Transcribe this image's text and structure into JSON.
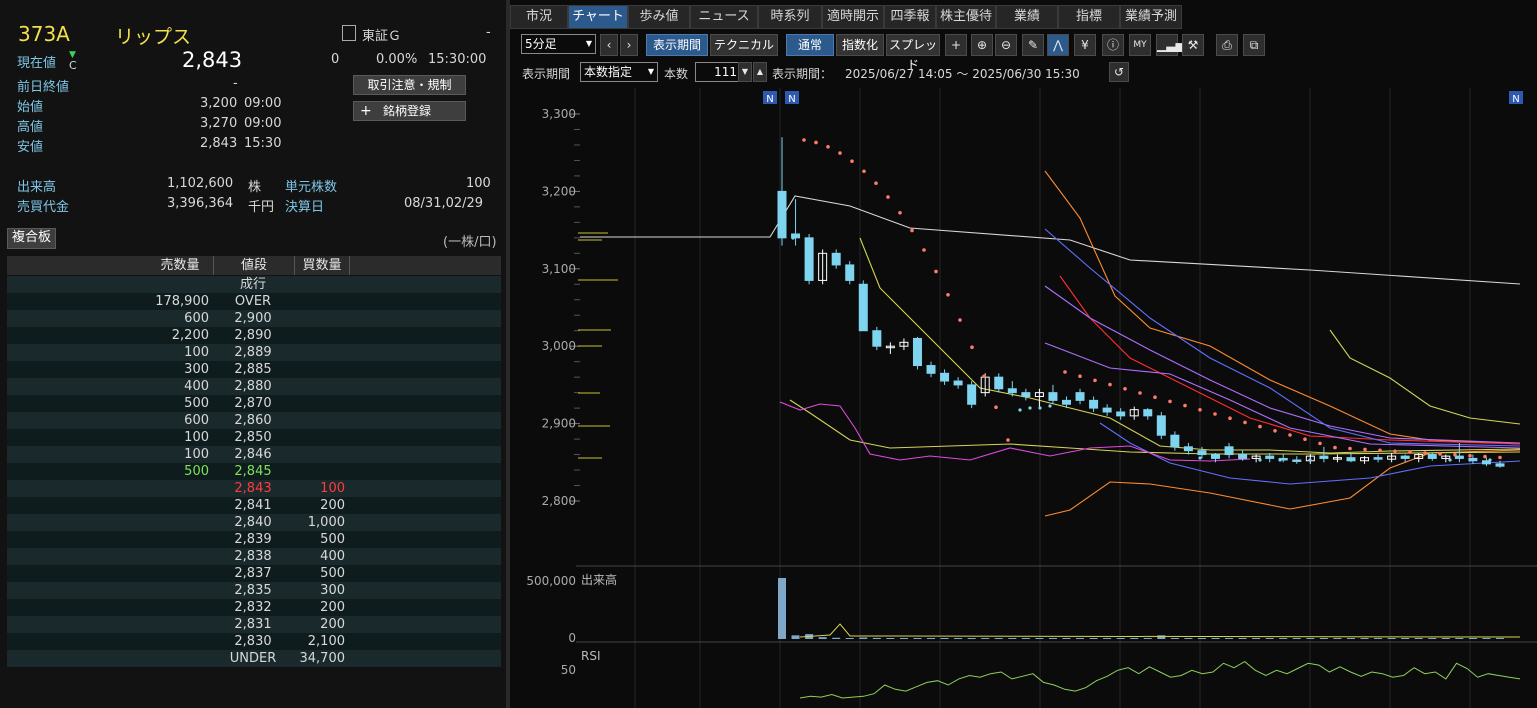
{
  "stock": {
    "code": "373A",
    "name": "リップス",
    "market": "東証Ｇ",
    "market_extra": "-",
    "current_label": "現在値",
    "current_mark": "C",
    "current_value": "2,843",
    "change": "0",
    "change_pct": "0.00%",
    "time": "15:30:00",
    "prev_close_label": "前日終値",
    "prev_close_value": "-",
    "open_label": "始値",
    "open_value": "3,200",
    "open_time": "09:00",
    "high_label": "高値",
    "high_value": "3,270",
    "high_time": "09:00",
    "low_label": "安値",
    "low_value": "2,843",
    "low_time": "15:30",
    "volume_label": "出来高",
    "volume_value": "1,102,600",
    "volume_unit": "株",
    "unit_label": "単元株数",
    "unit_value": "100",
    "turnover_label": "売買代金",
    "turnover_value": "3,396,364",
    "turnover_unit": "千円",
    "settle_label": "決算日",
    "settle_value": "08/31,02/29",
    "btn_caution": "取引注意・規制",
    "btn_register": "銘柄登録",
    "btn_register_icon": "+"
  },
  "board": {
    "tab_label": "複合板",
    "unit_note": "(一株/口)",
    "headers": [
      "売数量",
      "値段",
      "買数量"
    ],
    "rows": [
      {
        "sell": "",
        "price": "成行",
        "buy": ""
      },
      {
        "sell": "178,900",
        "price": "OVER",
        "buy": ""
      },
      {
        "sell": "600",
        "price": "2,900",
        "buy": ""
      },
      {
        "sell": "2,200",
        "price": "2,890",
        "buy": ""
      },
      {
        "sell": "100",
        "price": "2,889",
        "buy": ""
      },
      {
        "sell": "300",
        "price": "2,885",
        "buy": ""
      },
      {
        "sell": "400",
        "price": "2,880",
        "buy": ""
      },
      {
        "sell": "500",
        "price": "2,870",
        "buy": ""
      },
      {
        "sell": "600",
        "price": "2,860",
        "buy": ""
      },
      {
        "sell": "100",
        "price": "2,850",
        "buy": ""
      },
      {
        "sell": "100",
        "price": "2,846",
        "buy": ""
      },
      {
        "sell": "500",
        "price": "2,845",
        "buy": ""
      },
      {
        "sell": "",
        "price": "2,843",
        "buy": "100"
      },
      {
        "sell": "",
        "price": "2,841",
        "buy": "200"
      },
      {
        "sell": "",
        "price": "2,840",
        "buy": "1,000"
      },
      {
        "sell": "",
        "price": "2,839",
        "buy": "500"
      },
      {
        "sell": "",
        "price": "2,838",
        "buy": "400"
      },
      {
        "sell": "",
        "price": "2,837",
        "buy": "500"
      },
      {
        "sell": "",
        "price": "2,835",
        "buy": "300"
      },
      {
        "sell": "",
        "price": "2,832",
        "buy": "200"
      },
      {
        "sell": "",
        "price": "2,831",
        "buy": "200"
      },
      {
        "sell": "",
        "price": "2,830",
        "buy": "2,100"
      },
      {
        "sell": "",
        "price": "UNDER",
        "buy": "34,700"
      }
    ],
    "highlight_sell_color": "#7fe05a",
    "highlight_price_color": "#ff3b3b"
  },
  "tabs": [
    "市況",
    "チャート",
    "歩み値",
    "ニュース",
    "時系列",
    "適時開示",
    "四季報",
    "株主優待",
    "業績",
    "指標",
    "業績予測"
  ],
  "active_tab": "チャート",
  "toolbar": {
    "interval": "5分足",
    "btn_period": "表示期間",
    "btn_technical": "テクニカル",
    "btn_normal": "通常",
    "btn_index": "指数化",
    "btn_spread": "スプレッド",
    "period_label": "表示期間",
    "period_mode": "本数指定",
    "count_label": "本数",
    "count_value": "111",
    "range_label": "表示期間：",
    "range_value": "2025/06/27 14:05 ～ 2025/06/30 15:30",
    "icons": [
      "crosshair-icon",
      "zoom-in-icon",
      "zoom-out-icon",
      "pencil-icon",
      "chart-style-icon",
      "yen-icon",
      "info-icon",
      "my-icon",
      "volume-profile-icon",
      "wrench-icon",
      "print-icon",
      "popout-icon"
    ]
  },
  "chart": {
    "y_ticks": [
      "3,300",
      "3,200",
      "3,100",
      "3,000",
      "2,900",
      "2,800"
    ],
    "news_markers": [
      "N",
      "N",
      "N"
    ],
    "volume_label": "出来高",
    "volume_ticks": [
      "500,000",
      "0"
    ],
    "rsi_label": "RSI",
    "rsi_ticks": [
      "50"
    ],
    "colors": {
      "up": "#ffffff",
      "down": "#7fd4f0",
      "sar": "#ff7a6a",
      "ma_white": "#d8d8d8",
      "ma_orange": "#ff8c30",
      "ma_red": "#ff3030",
      "ma_purple": "#b070ff",
      "ma_blue": "#6070ff",
      "ma_yellow": "#d4d45a",
      "ma_magenta": "#e04ae0",
      "rsi": "#8fd05a"
    }
  },
  "chart_data": {
    "type": "candlestick",
    "title": "",
    "ylim": [
      2750,
      3320
    ],
    "candles": [
      {
        "o": 3200,
        "h": 3270,
        "l": 3130,
        "c": 3140
      },
      {
        "o": 3145,
        "h": 3190,
        "l": 3130,
        "c": 3140
      },
      {
        "o": 3140,
        "h": 3145,
        "l": 3080,
        "c": 3085
      },
      {
        "o": 3085,
        "h": 3125,
        "l": 3080,
        "c": 3120
      },
      {
        "o": 3120,
        "h": 3125,
        "l": 3100,
        "c": 3105
      },
      {
        "o": 3105,
        "h": 3110,
        "l": 3080,
        "c": 3085
      },
      {
        "o": 3080,
        "h": 3085,
        "l": 3020,
        "c": 3020
      },
      {
        "o": 3020,
        "h": 3025,
        "l": 2995,
        "c": 3000
      },
      {
        "o": 3000,
        "h": 3005,
        "l": 2990,
        "c": 3000
      },
      {
        "o": 3000,
        "h": 3010,
        "l": 2995,
        "c": 3005
      },
      {
        "o": 3010,
        "h": 3012,
        "l": 2970,
        "c": 2975
      },
      {
        "o": 2975,
        "h": 2980,
        "l": 2960,
        "c": 2965
      },
      {
        "o": 2965,
        "h": 2970,
        "l": 2950,
        "c": 2955
      },
      {
        "o": 2955,
        "h": 2960,
        "l": 2945,
        "c": 2950
      },
      {
        "o": 2950,
        "h": 2955,
        "l": 2920,
        "c": 2925
      },
      {
        "o": 2940,
        "h": 2965,
        "l": 2935,
        "c": 2960
      },
      {
        "o": 2960,
        "h": 2965,
        "l": 2940,
        "c": 2945
      },
      {
        "o": 2945,
        "h": 2955,
        "l": 2935,
        "c": 2940
      },
      {
        "o": 2940,
        "h": 2945,
        "l": 2930,
        "c": 2935
      },
      {
        "o": 2935,
        "h": 2945,
        "l": 2920,
        "c": 2940
      },
      {
        "o": 2940,
        "h": 2950,
        "l": 2925,
        "c": 2930
      },
      {
        "o": 2930,
        "h": 2935,
        "l": 2920,
        "c": 2925
      },
      {
        "o": 2940,
        "h": 2945,
        "l": 2925,
        "c": 2930
      },
      {
        "o": 2930,
        "h": 2935,
        "l": 2915,
        "c": 2920
      },
      {
        "o": 2920,
        "h": 2925,
        "l": 2910,
        "c": 2915
      },
      {
        "o": 2915,
        "h": 2920,
        "l": 2905,
        "c": 2910
      },
      {
        "o": 2910,
        "h": 2922,
        "l": 2905,
        "c": 2918
      },
      {
        "o": 2918,
        "h": 2920,
        "l": 2905,
        "c": 2910
      },
      {
        "o": 2910,
        "h": 2915,
        "l": 2880,
        "c": 2885
      },
      {
        "o": 2885,
        "h": 2890,
        "l": 2865,
        "c": 2870
      },
      {
        "o": 2870,
        "h": 2875,
        "l": 2860,
        "c": 2865
      },
      {
        "o": 2865,
        "h": 2870,
        "l": 2855,
        "c": 2860
      },
      {
        "o": 2860,
        "h": 2862,
        "l": 2850,
        "c": 2855
      },
      {
        "o": 2870,
        "h": 2875,
        "l": 2855,
        "c": 2860
      },
      {
        "o": 2860,
        "h": 2865,
        "l": 2852,
        "c": 2855
      },
      {
        "o": 2855,
        "h": 2860,
        "l": 2850,
        "c": 2858
      },
      {
        "o": 2858,
        "h": 2862,
        "l": 2850,
        "c": 2855
      },
      {
        "o": 2855,
        "h": 2860,
        "l": 2850,
        "c": 2853
      },
      {
        "o": 2853,
        "h": 2858,
        "l": 2848,
        "c": 2852
      },
      {
        "o": 2852,
        "h": 2860,
        "l": 2848,
        "c": 2858
      },
      {
        "o": 2858,
        "h": 2870,
        "l": 2850,
        "c": 2855
      },
      {
        "o": 2855,
        "h": 2860,
        "l": 2850,
        "c": 2856
      },
      {
        "o": 2856,
        "h": 2862,
        "l": 2850,
        "c": 2852
      },
      {
        "o": 2852,
        "h": 2858,
        "l": 2848,
        "c": 2856
      },
      {
        "o": 2856,
        "h": 2860,
        "l": 2850,
        "c": 2854
      },
      {
        "o": 2854,
        "h": 2862,
        "l": 2850,
        "c": 2858
      },
      {
        "o": 2858,
        "h": 2860,
        "l": 2850,
        "c": 2855
      },
      {
        "o": 2855,
        "h": 2862,
        "l": 2850,
        "c": 2860
      },
      {
        "o": 2860,
        "h": 2862,
        "l": 2852,
        "c": 2855
      },
      {
        "o": 2855,
        "h": 2860,
        "l": 2850,
        "c": 2858
      },
      {
        "o": 2858,
        "h": 2875,
        "l": 2850,
        "c": 2855
      },
      {
        "o": 2855,
        "h": 2860,
        "l": 2848,
        "c": 2852
      },
      {
        "o": 2852,
        "h": 2856,
        "l": 2845,
        "c": 2848
      },
      {
        "o": 2848,
        "h": 2852,
        "l": 2843,
        "c": 2845
      }
    ],
    "volume": [
      500000,
      30000,
      40000,
      15000,
      10000,
      8000,
      12000,
      9000,
      6000,
      5000,
      4000,
      3000,
      3000,
      2500,
      2500,
      2000,
      2000,
      2000,
      1500,
      1500,
      1500,
      1500,
      2000,
      1500,
      1500,
      1200,
      1200,
      1200,
      30000,
      2000,
      1500,
      1200,
      1000,
      1000,
      1000,
      1000,
      900,
      900,
      900,
      900,
      900,
      900,
      900,
      900,
      900,
      900,
      900,
      900,
      900,
      900,
      900,
      900,
      900,
      2000
    ],
    "rsi": [
      null,
      null,
      null,
      null,
      null,
      null,
      null,
      null,
      null,
      null,
      null,
      null,
      null,
      null,
      null,
      null,
      null,
      20,
      22,
      21,
      24,
      20,
      21,
      22,
      25,
      35,
      30,
      28,
      33,
      38,
      40,
      35,
      42,
      46,
      44,
      48,
      50,
      42,
      45,
      48,
      38,
      35,
      30,
      28,
      32,
      40,
      45,
      52,
      55,
      48,
      56,
      50,
      44,
      46,
      52,
      48,
      50,
      60,
      55,
      62,
      52,
      46,
      52,
      48,
      54,
      60,
      58,
      50,
      56,
      50,
      45,
      50,
      48,
      44,
      46,
      55,
      48,
      50,
      42,
      60,
      54,
      44,
      48,
      46,
      44,
      42
    ]
  }
}
